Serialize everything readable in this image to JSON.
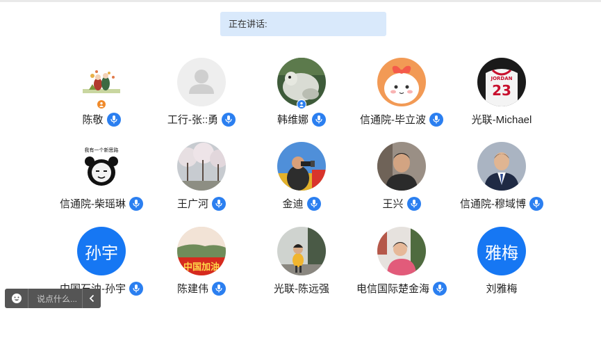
{
  "speaking": {
    "label": "正在讲话:"
  },
  "participants": [
    {
      "name": "陈敬",
      "mic": true
    },
    {
      "name": "工行-张::勇",
      "mic": true
    },
    {
      "name": "韩维娜",
      "mic": true
    },
    {
      "name": "信通院-毕立波",
      "mic": true
    },
    {
      "name": "光联-Michael",
      "mic": false
    },
    {
      "name": "信通院-柴瑶琳",
      "mic": true
    },
    {
      "name": "王广河",
      "mic": true
    },
    {
      "name": "金迪",
      "mic": true
    },
    {
      "name": "王兴",
      "mic": true
    },
    {
      "name": "信通院-穆域博",
      "mic": true
    },
    {
      "name": "中国石油-孙宇",
      "mic": true,
      "initials": "孙宇"
    },
    {
      "name": "陈建伟",
      "mic": true
    },
    {
      "name": "光联-陈远强",
      "mic": false
    },
    {
      "name": "电信国际楚金海",
      "mic": true
    },
    {
      "name": "刘雅梅",
      "mic": false,
      "initials": "雅梅"
    }
  ],
  "avatar_texts": {
    "panda_caption": "我有一个新思路",
    "jersey": "JORDAN",
    "jersey_number": "23",
    "banner": "中国加油"
  },
  "chat": {
    "placeholder": "说点什么...",
    "emoji_icon": "smiley-icon",
    "toggle_icon": "chevron-left-icon"
  },
  "colors": {
    "accent": "#2b7ff0",
    "speaking_bg": "#d9e9fb",
    "chat_bg": "#555555"
  }
}
